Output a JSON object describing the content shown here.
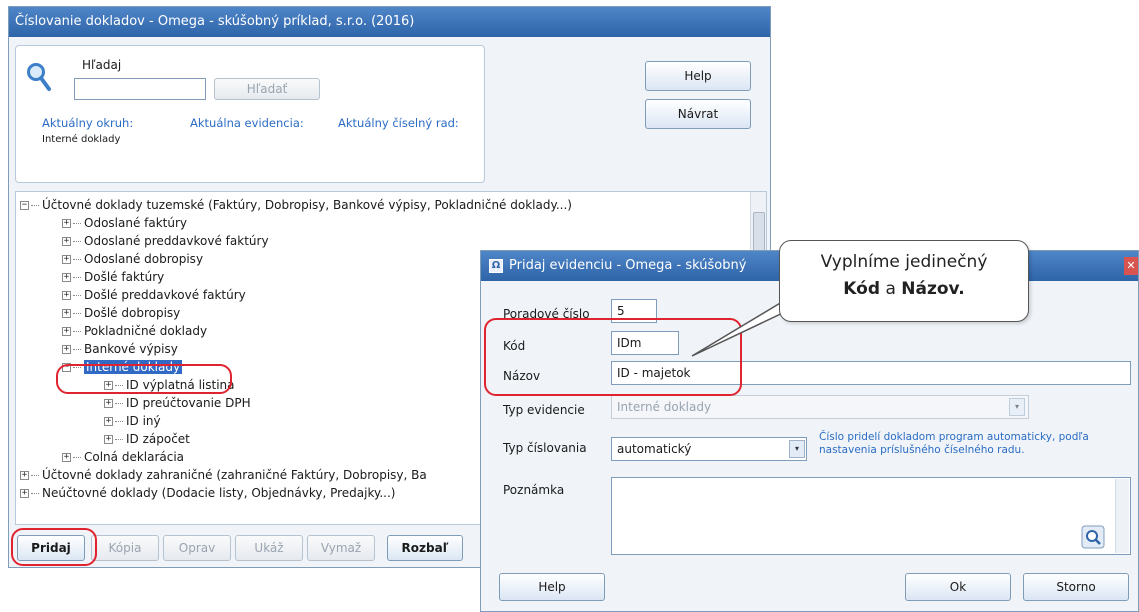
{
  "main_window": {
    "title": "Číslovanie dokladov - Omega - skúšobný príklad, s.r.o. (2016)",
    "search": {
      "label": "Hľadaj",
      "value": "",
      "button": "Hľadať"
    },
    "help_button": "Help",
    "back_button": "Návrat",
    "current": {
      "okruh_label": "Aktuálny okruh:",
      "okruh_value": "Interné doklady",
      "evidencia_label": "Aktuálna evidencia:",
      "rad_label": "Aktuálny číselný rad:"
    },
    "tree": [
      {
        "sign": "−",
        "label": "Účtovné doklady tuzemské (Faktúry, Dobropisy, Bankové výpisy, Pokladničné doklady...)"
      },
      {
        "sign": "+",
        "label": "Odoslané faktúry"
      },
      {
        "sign": "+",
        "label": "Odoslané preddavkové faktúry"
      },
      {
        "sign": "+",
        "label": "Odoslané dobropisy"
      },
      {
        "sign": "+",
        "label": "Došlé faktúry"
      },
      {
        "sign": "+",
        "label": "Došlé preddavkové faktúry"
      },
      {
        "sign": "+",
        "label": "Došlé dobropisy"
      },
      {
        "sign": "+",
        "label": "Pokladničné doklady"
      },
      {
        "sign": "+",
        "label": "Bankové výpisy"
      },
      {
        "sign": "−",
        "label": "Interné doklady"
      },
      {
        "sign": "+",
        "label": "ID výplatná listina"
      },
      {
        "sign": "+",
        "label": "ID preúčtovanie DPH"
      },
      {
        "sign": "+",
        "label": "ID iný"
      },
      {
        "sign": "+",
        "label": "ID zápočet"
      },
      {
        "sign": "+",
        "label": "Colná deklarácia"
      },
      {
        "sign": "+",
        "label": "Účtovné doklady zahraničné (zahraničné Faktúry, Dobropisy, Ba"
      },
      {
        "sign": "+",
        "label": "Neúčtovné doklady (Dodacie listy, Objednávky, Predajky...)"
      }
    ],
    "bottom_buttons": {
      "add": "Pridaj",
      "copy": "Kópia",
      "edit": "Oprav",
      "show": "Ukáž",
      "delete": "Vymaž",
      "expand": "Rozbaľ"
    }
  },
  "dialog": {
    "title": "Pridaj evidenciu - Omega - skúšobný",
    "fields": {
      "poradove_label": "Poradové číslo",
      "poradove_value": "5",
      "kod_label": "Kód",
      "kod_value": "IDm",
      "nazov_label": "Názov",
      "nazov_value": "ID - majetok",
      "typ_evidencie_label": "Typ evidencie",
      "typ_evidencie_value": "Interné doklady",
      "typ_cislovania_label": "Typ číslovania",
      "typ_cislovania_value": "automatický",
      "typ_cislovania_hint": "Číslo pridelí dokladom program automaticky, podľa nastavenia príslušného číselného radu.",
      "poznamka_label": "Poznámka",
      "poznamka_value": ""
    },
    "help_button": "Help",
    "ok_button": "Ok",
    "cancel_button": "Storno"
  },
  "callout": {
    "line1": "Vyplníme jedinečný",
    "kod": "Kód",
    "a": "a",
    "nazov": "Názov."
  },
  "colors": {
    "title_bar": "#2e64a8",
    "selection": "#316ac5",
    "highlight": "#e0242f",
    "link_label": "#2b6cc4"
  }
}
